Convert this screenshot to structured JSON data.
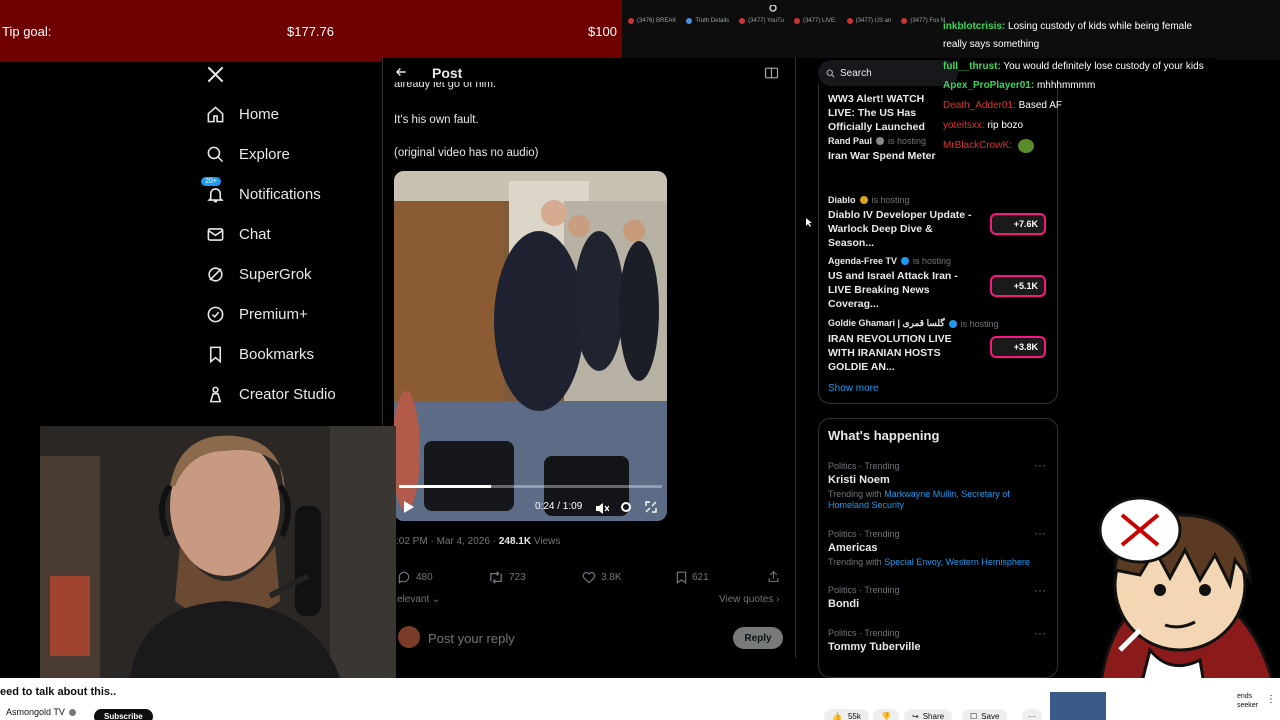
{
  "tip_goal": {
    "label": "Tip goal:",
    "current": "$177.76",
    "target": "$100"
  },
  "browser_tabs": [
    "(3476) BREAK",
    "Truth Details",
    "(3477) YouTu",
    "(3477) LIVE:",
    "(3477) US an",
    "(3477) Fox N"
  ],
  "nav": {
    "items": [
      {
        "label": "Home",
        "icon": "home-icon"
      },
      {
        "label": "Explore",
        "icon": "search-icon"
      },
      {
        "label": "Notifications",
        "icon": "bell-icon",
        "badge": "20+"
      },
      {
        "label": "Chat",
        "icon": "mail-icon"
      },
      {
        "label": "SuperGrok",
        "icon": "grok-icon"
      },
      {
        "label": "Premium+",
        "icon": "verified-icon"
      },
      {
        "label": "Bookmarks",
        "icon": "bookmark-icon"
      },
      {
        "label": "Creator Studio",
        "icon": "creator-icon"
      }
    ]
  },
  "post": {
    "header": "Post",
    "text_partial": "already let go of him.",
    "text1": "It's his own fault.",
    "text2": "(original video has no audio)",
    "video_time": "0:24 / 1:09",
    "video_progress": 0.35,
    "timestamp": ":02 PM · Mar 4, 2026 · ",
    "views_count": "248.1K",
    "views_label": " Views",
    "replies": "480",
    "reposts": "723",
    "likes": "3.8K",
    "bookmarks": "621",
    "sort_label": "elevant",
    "view_quotes": "View quotes",
    "reply_placeholder": "Post your reply",
    "reply_button": "Reply"
  },
  "search": {
    "placeholder": "Search"
  },
  "live": {
    "items": [
      {
        "host": "",
        "title": "WW3 Alert! WATCH LIVE: The US Has Officially Launched"
      },
      {
        "host": "Rand Paul",
        "status": "is hosting",
        "title": "Iran War Spend Meter"
      },
      {
        "host": "Diablo",
        "status": "is hosting",
        "title": "Diablo IV Developer Update - Warlock Deep Dive & Season...",
        "count": "+7.6K"
      },
      {
        "host": "Agenda-Free TV",
        "status": "is hosting",
        "title": "US and Israel Attack Iran - LIVE Breaking News Coverag...",
        "count": "+5.1K"
      },
      {
        "host": "Goldie Ghamari | گلسا قمری",
        "status": "is hosting",
        "title": "IRAN REVOLUTION LIVE WITH IRANIAN HOSTS GOLDIE AN...",
        "count": "+3.8K"
      }
    ],
    "show_more": "Show more"
  },
  "happening": {
    "title": "What's happening",
    "trends": [
      {
        "category": "Politics · Trending",
        "name": "Kristi Noem",
        "with_prefix": "Trending with ",
        "with": "Markwayne Mullin, Secretary of Homeland Security"
      },
      {
        "category": "Politics · Trending",
        "name": "Americas",
        "with_prefix": "Trending with ",
        "with": "Special Envoy, Western Hemisphere"
      },
      {
        "category": "Politics · Trending",
        "name": "Bondi",
        "with_prefix": "",
        "with": ""
      },
      {
        "category": "Politics · Trending",
        "name": "Tommy Tuberville",
        "with_prefix": "",
        "with": ""
      }
    ]
  },
  "chat": [
    {
      "user": "inkblotcrisis:",
      "msg": "Losing custody of kids while being female really says something",
      "color": "#3cd65b"
    },
    {
      "user": "full__thrust:",
      "msg": "You would definitely lose custody of your kids",
      "color": "#3cd65b"
    },
    {
      "user": "Apex_ProPlayer01:",
      "msg": "mhhhmmmm",
      "color": "#3cd65b"
    },
    {
      "user": "Death_Adder01:",
      "msg": "Based AF",
      "color": "#d93333"
    },
    {
      "user": "yoteitsxx:",
      "msg": "rip bozo",
      "color": "#d93333"
    },
    {
      "user": "MrBlackCrowK:",
      "msg": "",
      "color": "#d93333"
    }
  ],
  "youtube": {
    "video_title": "eed to talk about this..",
    "channel": "Asmongold TV",
    "subscribe": "Subscribe",
    "likes": "55k",
    "share": "Share",
    "save": "Save",
    "side_text1": "ends",
    "side_text2": "seeker"
  }
}
